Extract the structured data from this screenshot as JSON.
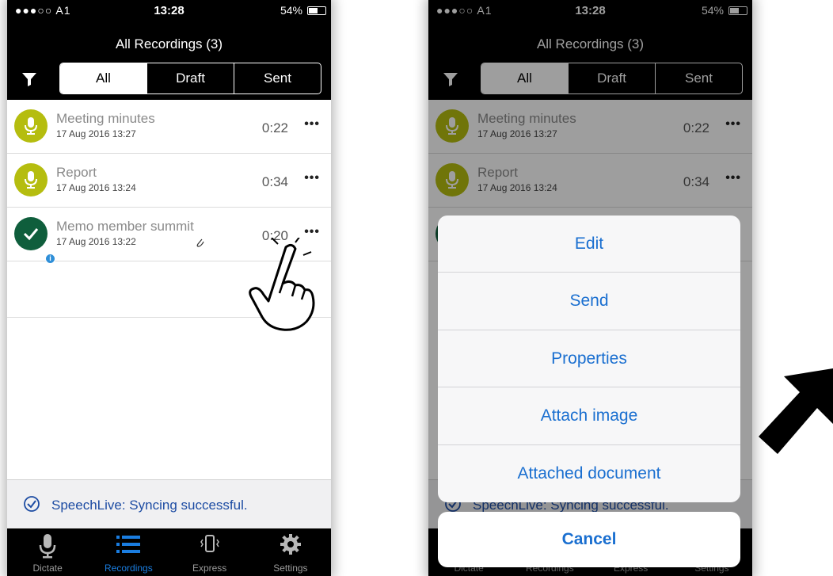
{
  "status": {
    "carrier": "●●●○○ A1",
    "time": "13:28",
    "battery": "54%"
  },
  "header": {
    "title": "All Recordings (3)"
  },
  "tabs": [
    "All",
    "Draft",
    "Sent"
  ],
  "recordings": [
    {
      "name": "Meeting minutes",
      "date": "17 Aug 2016 13:27",
      "duration": "0:22",
      "state": "draft"
    },
    {
      "name": "Report",
      "date": "17 Aug 2016 13:24",
      "duration": "0:34",
      "state": "draft"
    },
    {
      "name": "Memo member summit",
      "date": "17 Aug 2016 13:22",
      "duration": "0:20",
      "state": "done"
    }
  ],
  "more_glyph": "•••",
  "sync": {
    "text": "SpeechLive: Syncing successful."
  },
  "tabbar": [
    {
      "label": "Dictate",
      "icon": "microphone-icon"
    },
    {
      "label": "Recordings",
      "icon": "list-icon"
    },
    {
      "label": "Express",
      "icon": "vibrate-phone-icon"
    },
    {
      "label": "Settings",
      "icon": "gear-icon"
    }
  ],
  "action_sheet": {
    "items": [
      "Edit",
      "Send",
      "Properties",
      "Attach image",
      "Attached document"
    ],
    "cancel": "Cancel"
  },
  "colors": {
    "accent": "#1a6fd0",
    "draft_avatar": "#b5bd0f",
    "done_avatar": "#0f5e3c"
  }
}
